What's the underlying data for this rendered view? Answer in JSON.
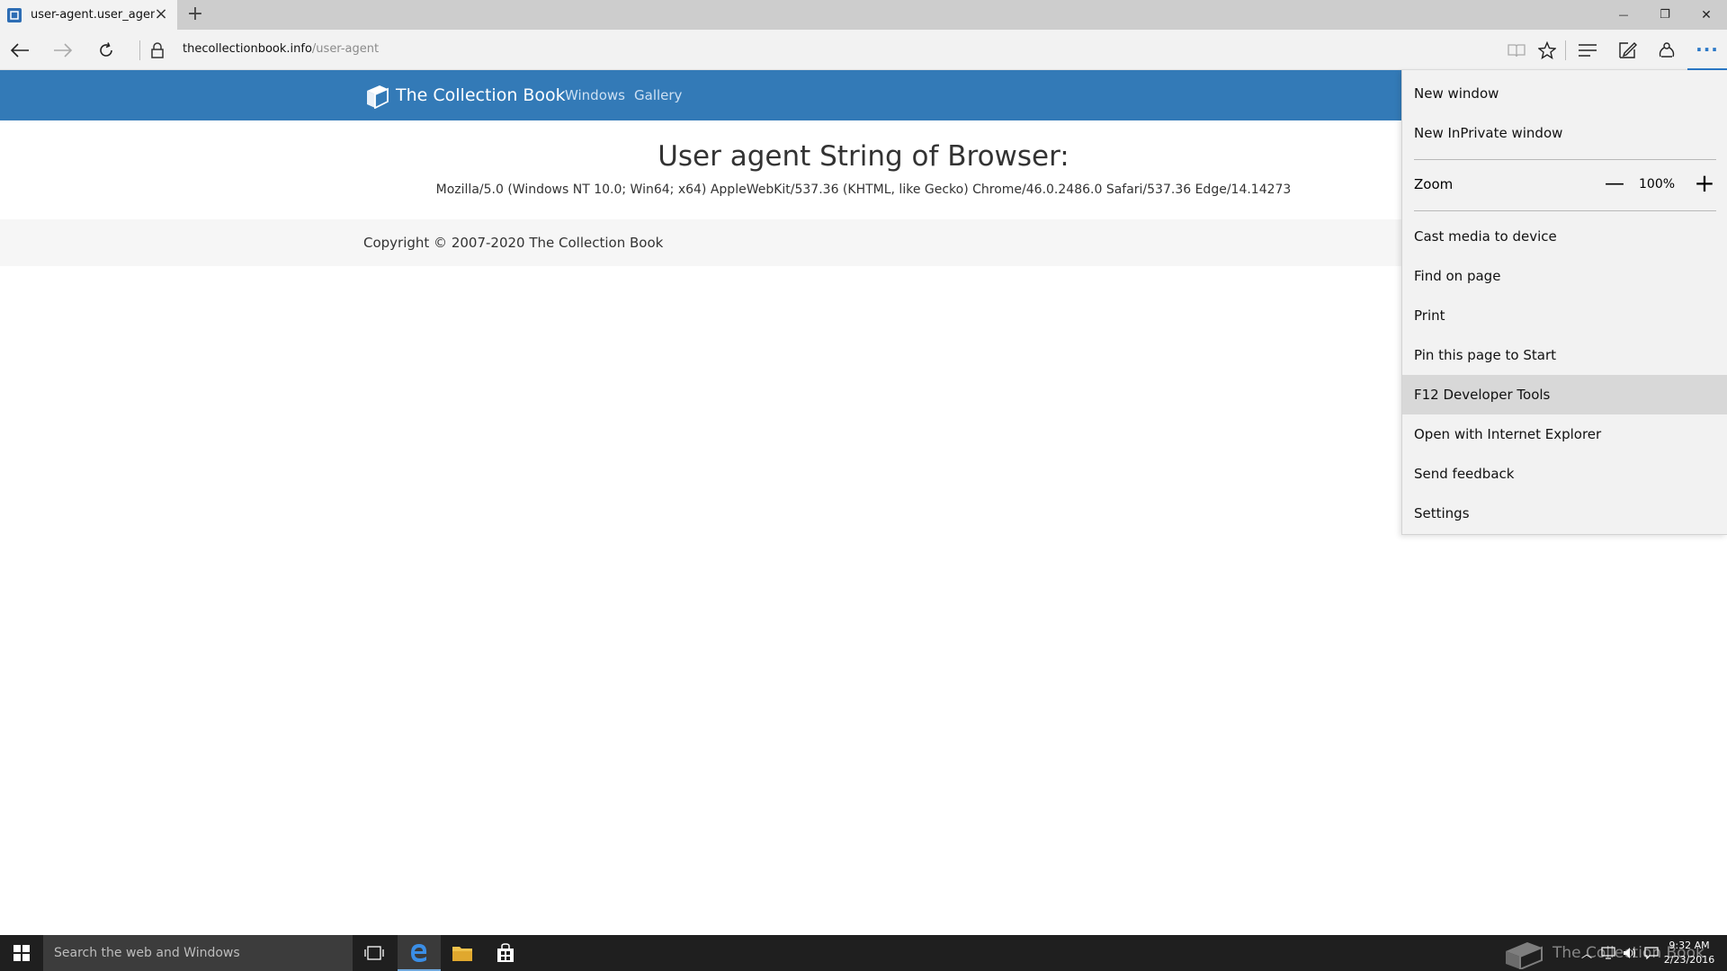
{
  "browser": {
    "tab": {
      "title": "user-agent.user_agent - ",
      "close_glyph": "×",
      "new_tab_glyph": "+"
    },
    "window_controls": {
      "minimize": "—",
      "restore": "❐",
      "close": "✕"
    },
    "address": {
      "host": "thecollectionbook.info",
      "path": "/user-agent"
    },
    "more_glyph": "···",
    "accent_color": "#2c79c7"
  },
  "site": {
    "brand": "The Collection Book",
    "nav": [
      "Windows",
      "Gallery"
    ],
    "header_color": "#337ab7",
    "title": "User agent String of Browser:",
    "ua_string": "Mozilla/5.0 (Windows NT 10.0; Win64; x64) AppleWebKit/537.36 (KHTML, like Gecko) Chrome/46.0.2486.0 Safari/537.36 Edge/14.14273",
    "copyright": "Copyright © 2007-2020 The Collection Book"
  },
  "menu": {
    "items_top": [
      "New window",
      "New InPrivate window"
    ],
    "zoom": {
      "label": "Zoom",
      "minus": "—",
      "value": "100%",
      "plus": "+"
    },
    "items_bottom": [
      "Cast media to device",
      "Find on page",
      "Print",
      "Pin this page to Start",
      "F12 Developer Tools",
      "Open with Internet Explorer",
      "Send feedback",
      "Settings"
    ],
    "hovered_item": "F12 Developer Tools"
  },
  "taskbar": {
    "search_placeholder": "Search the web and Windows",
    "watermark": "The Collection Book",
    "clock_time": "9:32 AM",
    "clock_date": "2/23/2016"
  }
}
